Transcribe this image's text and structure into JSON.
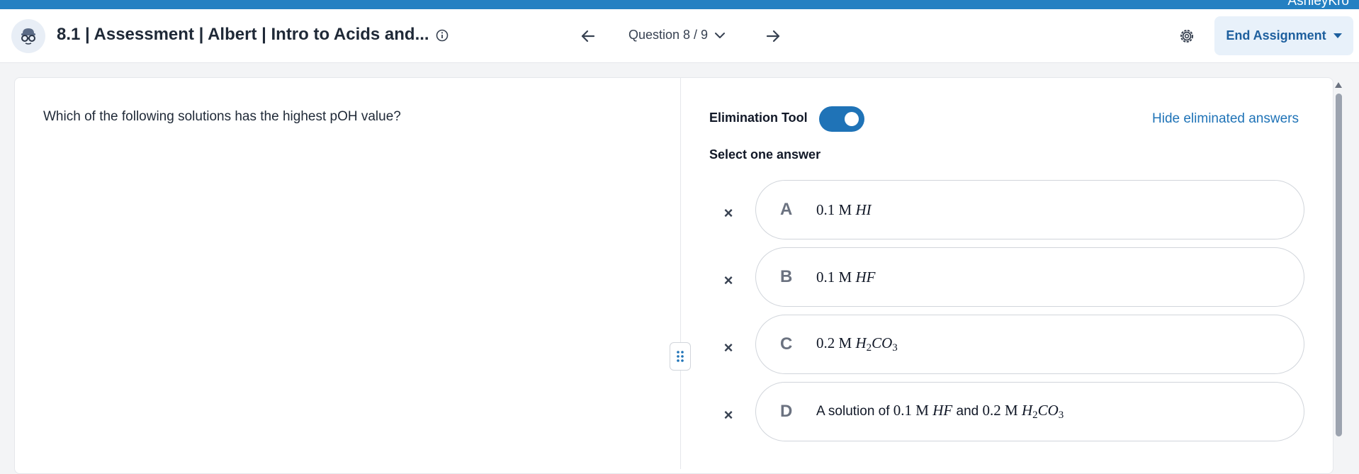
{
  "topbar": {
    "user_name": "AshleyKro"
  },
  "header": {
    "title": "8.1 | Assessment | Albert | Intro to Acids and...",
    "question_selector": "Question 8 / 9",
    "end_button": "End Assignment"
  },
  "question": {
    "text": "Which of the following solutions has the highest pOH value?"
  },
  "answers_panel": {
    "elimination_label": "Elimination Tool",
    "elimination_enabled": true,
    "hide_link": "Hide eliminated answers",
    "select_label": "Select one answer",
    "choices": [
      {
        "letter": "A",
        "parts": [
          {
            "t": "num",
            "v": "0.1 M "
          },
          {
            "t": "it",
            "v": "HI"
          }
        ]
      },
      {
        "letter": "B",
        "parts": [
          {
            "t": "num",
            "v": "0.1 M "
          },
          {
            "t": "it",
            "v": "HF"
          }
        ]
      },
      {
        "letter": "C",
        "parts": [
          {
            "t": "num",
            "v": "0.2 M "
          },
          {
            "t": "it",
            "v": "H"
          },
          {
            "t": "sub",
            "v": "2"
          },
          {
            "t": "it",
            "v": "CO"
          },
          {
            "t": "sub",
            "v": "3"
          }
        ]
      },
      {
        "letter": "D",
        "parts": [
          {
            "t": "plain",
            "v": "A solution of "
          },
          {
            "t": "num",
            "v": "0.1 M "
          },
          {
            "t": "it",
            "v": "HF"
          },
          {
            "t": "plain",
            "v": " and "
          },
          {
            "t": "num",
            "v": "0.2 M "
          },
          {
            "t": "it",
            "v": "H"
          },
          {
            "t": "sub",
            "v": "2"
          },
          {
            "t": "it",
            "v": "CO"
          },
          {
            "t": "sub",
            "v": "3"
          }
        ]
      }
    ]
  },
  "colors": {
    "brand_blue": "#2480c2",
    "toggle_blue": "#1f73b7",
    "end_button_bg": "#e8f1fa"
  },
  "icons": [
    "avatar-icon",
    "info-icon",
    "arrow-left-icon",
    "chevron-down-icon",
    "arrow-right-icon",
    "gear-icon",
    "caret-down-icon",
    "drag-handle-icon",
    "close-icon"
  ]
}
